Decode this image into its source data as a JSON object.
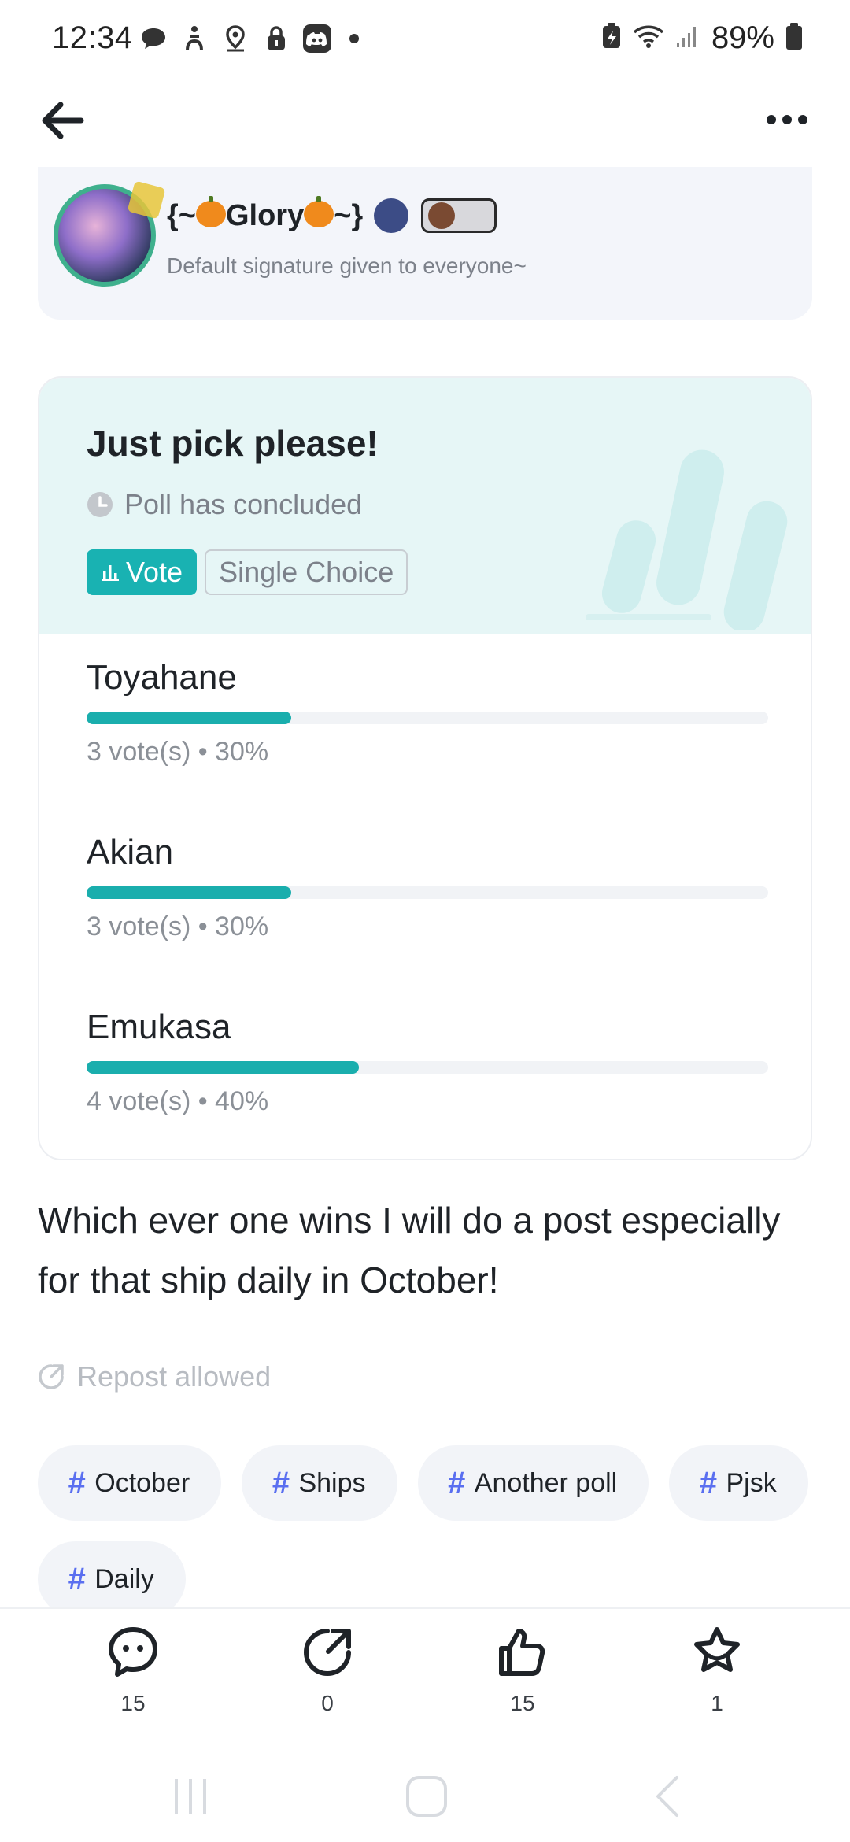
{
  "status_bar": {
    "time": "12:34",
    "battery": "89%",
    "left_icons": [
      "chat-icon",
      "accessibility-icon",
      "location-icon",
      "lock-icon",
      "discord-icon"
    ],
    "right_icons": [
      "battery-saver-icon",
      "wifi-icon",
      "signal-icon",
      "battery-icon"
    ]
  },
  "app_bar": {
    "back_icon": "arrow-left-icon",
    "more_icon": "more-horizontal-icon"
  },
  "author": {
    "name_prefix": "{~",
    "name_main": "Glory",
    "name_suffix": "~}",
    "signature": "Default signature given to everyone~"
  },
  "poll": {
    "title": "Just pick please!",
    "status": "Poll has concluded",
    "vote_tag": "Vote",
    "choice_tag": "Single Choice",
    "accent": "#1aaead",
    "options": [
      {
        "label": "Toyahane",
        "meta": "3 vote(s) • 30%",
        "percent": 30
      },
      {
        "label": "Akian",
        "meta": "3 vote(s) • 30%",
        "percent": 30
      },
      {
        "label": "Emukasa",
        "meta": "4 vote(s) • 40%",
        "percent": 40
      }
    ]
  },
  "post": {
    "text": "Which ever one wins I will do a post especially for that ship daily in October!",
    "repost": "Repost allowed"
  },
  "hashtags": [
    "October",
    "Ships",
    "Another poll",
    "Pjsk",
    "Daily"
  ],
  "actions": [
    {
      "icon": "comment-icon",
      "count": "15"
    },
    {
      "icon": "share-icon",
      "count": "0"
    },
    {
      "icon": "like-icon",
      "count": "15"
    },
    {
      "icon": "favorite-icon",
      "count": "1"
    }
  ]
}
